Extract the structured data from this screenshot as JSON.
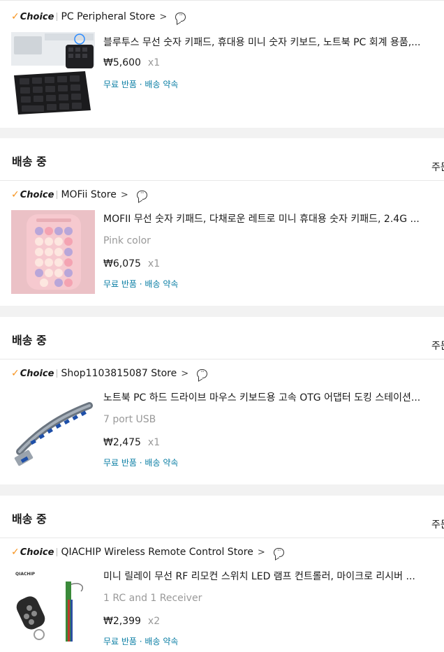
{
  "choice_label": "Choice",
  "orders": [
    {
      "store": "PC Peripheral Store",
      "item": {
        "title": "블루투스 무선 숫자 키패드, 휴대용 미니 숫자 키보드, 노트북 PC 회계 용품,...",
        "price": "₩5,600",
        "qty": "x1",
        "perks": "무료 반품 · 배송 약속"
      }
    },
    {
      "status": "배송 중",
      "detail": "주문",
      "store": "MOFii Store",
      "item": {
        "title": "MOFII 무선 숫자 키패드, 다채로운 레트로 미니 휴대용 숫자 키패드, 2.4G ...",
        "variant": "Pink color",
        "price": "₩6,075",
        "qty": "x1",
        "perks": "무료 반품 · 배송 약속"
      }
    },
    {
      "status": "배송 중",
      "detail": "주문",
      "store": "Shop1103815087 Store",
      "item": {
        "title": "노트북 PC 하드 드라이브 마우스 키보드용 고속 OTG 어댑터 도킹 스테이션...",
        "variant": "7 port USB",
        "price": "₩2,475",
        "qty": "x1",
        "perks": "무료 반품 · 배송 약속"
      }
    },
    {
      "status": "배송 중",
      "detail": "주문",
      "store": "QIACHIP Wireless Remote Control Store",
      "item": {
        "title": "미니 릴레이 무선 RF 리모컨 스위치 LED 램프 컨트롤러, 마이크로 리시버 ...",
        "variant": "1 RC and 1 Receiver",
        "price": "₩2,399",
        "qty": "x2",
        "perks": "무료 반품 · 배송 약속",
        "image_brand": "QIACHIP"
      }
    }
  ]
}
